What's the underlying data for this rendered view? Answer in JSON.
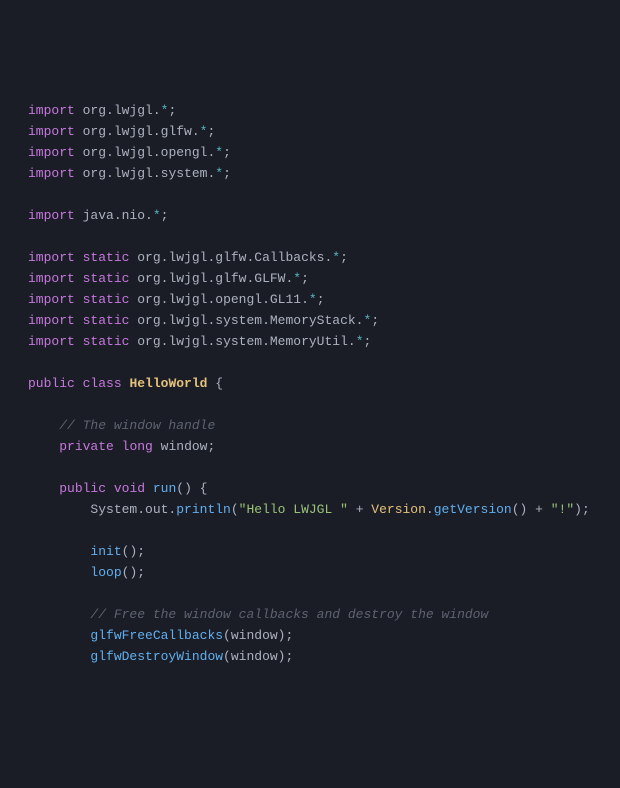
{
  "code": {
    "l1": {
      "kw": "import",
      "pkg": "org.lwjgl.",
      "star": "*",
      "semi": ";"
    },
    "l2": {
      "kw": "import",
      "pkg": "org.lwjgl.glfw.",
      "star": "*",
      "semi": ";"
    },
    "l3": {
      "kw": "import",
      "pkg": "org.lwjgl.opengl.",
      "star": "*",
      "semi": ";"
    },
    "l4": {
      "kw": "import",
      "pkg": "org.lwjgl.system.",
      "star": "*",
      "semi": ";"
    },
    "l5": {
      "kw": "import",
      "pkg": "java.nio.",
      "star": "*",
      "semi": ";"
    },
    "l6": {
      "kw1": "import",
      "kw2": "static",
      "pkg": "org.lwjgl.glfw.Callbacks.",
      "star": "*",
      "semi": ";"
    },
    "l7": {
      "kw1": "import",
      "kw2": "static",
      "pkg": "org.lwjgl.glfw.GLFW.",
      "star": "*",
      "semi": ";"
    },
    "l8": {
      "kw1": "import",
      "kw2": "static",
      "pkg": "org.lwjgl.opengl.GL11.",
      "star": "*",
      "semi": ";"
    },
    "l9": {
      "kw1": "import",
      "kw2": "static",
      "pkg": "org.lwjgl.system.MemoryStack.",
      "star": "*",
      "semi": ";"
    },
    "l10": {
      "kw1": "import",
      "kw2": "static",
      "pkg": "org.lwjgl.system.MemoryUtil.",
      "star": "*",
      "semi": ";"
    },
    "l11": {
      "kw1": "public",
      "kw2": "class",
      "name": "HelloWorld",
      "brace": " {"
    },
    "l12": {
      "comment": "// The window handle"
    },
    "l13": {
      "kw1": "private",
      "kw2": "long",
      "name": "window",
      "semi": ";"
    },
    "l14": {
      "kw1": "public",
      "kw2": "void",
      "name": "run",
      "sig": "() {"
    },
    "l15": {
      "obj": "System.out.",
      "method": "println",
      "open": "(",
      "str1": "\"Hello LWJGL \"",
      "plus1": " + ",
      "type": "Version",
      "dot": ".",
      "method2": "getVersion",
      "call": "()",
      "plus2": " + ",
      "str2": "\"!\"",
      "close": ");"
    },
    "l16": {
      "method": "init",
      "call": "();"
    },
    "l17": {
      "method": "loop",
      "call": "();"
    },
    "l18": {
      "comment": "// Free the window callbacks and destroy the window"
    },
    "l19": {
      "method": "glfwFreeCallbacks",
      "open": "(",
      "arg": "window",
      "close": ");"
    },
    "l20": {
      "method": "glfwDestroyWindow",
      "open": "(",
      "arg": "window",
      "close": ");"
    }
  }
}
